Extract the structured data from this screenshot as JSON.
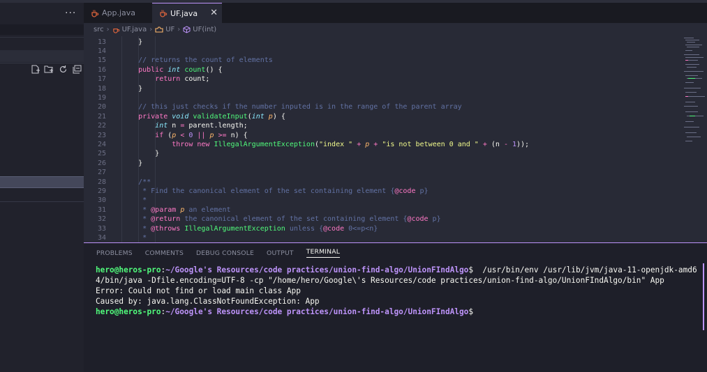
{
  "sidebar": {
    "more_label": "···"
  },
  "tabs": [
    {
      "label": "App.java",
      "active": false
    },
    {
      "label": "UF.java",
      "active": true,
      "close": "✕"
    }
  ],
  "breadcrumb": {
    "folder": "src",
    "file": "UF.java",
    "class": "UF",
    "method": "UF(int)"
  },
  "editor": {
    "lines": [
      {
        "num": "13",
        "indent": 1,
        "tokens": [
          {
            "t": "}",
            "c": ""
          }
        ]
      },
      {
        "num": "14",
        "indent": 0,
        "tokens": []
      },
      {
        "num": "15",
        "indent": 1,
        "tokens": [
          {
            "t": "// returns the count of elements",
            "c": "c"
          }
        ]
      },
      {
        "num": "16",
        "indent": 1,
        "tokens": [
          {
            "t": "public ",
            "c": "k"
          },
          {
            "t": "int ",
            "c": "t"
          },
          {
            "t": "count",
            "c": "f"
          },
          {
            "t": "() {",
            "c": ""
          }
        ]
      },
      {
        "num": "17",
        "indent": 2,
        "tokens": [
          {
            "t": "return ",
            "c": "k"
          },
          {
            "t": "count;",
            "c": ""
          }
        ]
      },
      {
        "num": "18",
        "indent": 1,
        "tokens": [
          {
            "t": "}",
            "c": ""
          }
        ]
      },
      {
        "num": "19",
        "indent": 0,
        "tokens": []
      },
      {
        "num": "20",
        "indent": 1,
        "tokens": [
          {
            "t": "// this just checks if the number inputed is in the range of the parent array",
            "c": "c"
          }
        ]
      },
      {
        "num": "21",
        "indent": 1,
        "tokens": [
          {
            "t": "private ",
            "c": "k"
          },
          {
            "t": "void ",
            "c": "t"
          },
          {
            "t": "validateInput",
            "c": "f"
          },
          {
            "t": "(",
            "c": ""
          },
          {
            "t": "int ",
            "c": "t"
          },
          {
            "t": "p",
            "c": "p"
          },
          {
            "t": ") {",
            "c": ""
          }
        ]
      },
      {
        "num": "22",
        "indent": 2,
        "tokens": [
          {
            "t": "int ",
            "c": "t"
          },
          {
            "t": "n ",
            "c": ""
          },
          {
            "t": "= ",
            "c": "k"
          },
          {
            "t": "parent.length;",
            "c": ""
          }
        ]
      },
      {
        "num": "23",
        "indent": 2,
        "tokens": [
          {
            "t": "if ",
            "c": "k"
          },
          {
            "t": "(",
            "c": ""
          },
          {
            "t": "p",
            "c": "p"
          },
          {
            "t": " < ",
            "c": "k"
          },
          {
            "t": "0",
            "c": "n"
          },
          {
            "t": " || ",
            "c": "k"
          },
          {
            "t": "p",
            "c": "p"
          },
          {
            "t": " >= ",
            "c": "k"
          },
          {
            "t": "n) {",
            "c": ""
          }
        ]
      },
      {
        "num": "24",
        "indent": 3,
        "tokens": [
          {
            "t": "throw ",
            "c": "k"
          },
          {
            "t": "new ",
            "c": "k"
          },
          {
            "t": "IllegalArgumentException",
            "c": "f"
          },
          {
            "t": "(",
            "c": ""
          },
          {
            "t": "\"index \"",
            "c": "s"
          },
          {
            "t": " + ",
            "c": "k"
          },
          {
            "t": "p",
            "c": "p"
          },
          {
            "t": " + ",
            "c": "k"
          },
          {
            "t": "\"is not between 0 and \"",
            "c": "s"
          },
          {
            "t": " + ",
            "c": "k"
          },
          {
            "t": "(n ",
            "c": ""
          },
          {
            "t": "- ",
            "c": "k"
          },
          {
            "t": "1",
            "c": "n"
          },
          {
            "t": "));",
            "c": ""
          }
        ]
      },
      {
        "num": "25",
        "indent": 2,
        "tokens": [
          {
            "t": "}",
            "c": ""
          }
        ]
      },
      {
        "num": "26",
        "indent": 1,
        "tokens": [
          {
            "t": "}",
            "c": ""
          }
        ]
      },
      {
        "num": "27",
        "indent": 0,
        "tokens": []
      },
      {
        "num": "28",
        "indent": 1,
        "tokens": [
          {
            "t": "/**",
            "c": "c"
          }
        ]
      },
      {
        "num": "29",
        "indent": 1,
        "tokens": [
          {
            "t": " * Find the canonical element of the set containing element {",
            "c": "c"
          },
          {
            "t": "@code",
            "c": "k"
          },
          {
            "t": " p}",
            "c": "c"
          }
        ]
      },
      {
        "num": "30",
        "indent": 1,
        "tokens": [
          {
            "t": " *",
            "c": "c"
          }
        ]
      },
      {
        "num": "31",
        "indent": 1,
        "tokens": [
          {
            "t": " * ",
            "c": "c"
          },
          {
            "t": "@param",
            "c": "k"
          },
          {
            "t": " ",
            "c": "c"
          },
          {
            "t": "p",
            "c": "p"
          },
          {
            "t": " an element",
            "c": "c"
          }
        ]
      },
      {
        "num": "32",
        "indent": 1,
        "tokens": [
          {
            "t": " * ",
            "c": "c"
          },
          {
            "t": "@return",
            "c": "k"
          },
          {
            "t": " the canonical element of the set containing element {",
            "c": "c"
          },
          {
            "t": "@code",
            "c": "k"
          },
          {
            "t": " p}",
            "c": "c"
          }
        ]
      },
      {
        "num": "33",
        "indent": 1,
        "tokens": [
          {
            "t": " * ",
            "c": "c"
          },
          {
            "t": "@throws",
            "c": "k"
          },
          {
            "t": " IllegalArgumentException",
            "c": "f"
          },
          {
            "t": " unless {",
            "c": "c"
          },
          {
            "t": "@code",
            "c": "k"
          },
          {
            "t": " 0<=p<n}",
            "c": "c"
          }
        ]
      },
      {
        "num": "34",
        "indent": 1,
        "tokens": [
          {
            "t": " *",
            "c": "c"
          }
        ]
      }
    ]
  },
  "panel": {
    "tabs": [
      {
        "label": "PROBLEMS",
        "active": false
      },
      {
        "label": "COMMENTS",
        "active": false
      },
      {
        "label": "DEBUG CONSOLE",
        "active": false
      },
      {
        "label": "OUTPUT",
        "active": false
      },
      {
        "label": "TERMINAL",
        "active": true
      }
    ],
    "terminal": {
      "user": "hero@heros-pro",
      "cwd": "~/Google's Resources/code practices/union-find-algo/UnionFIndAlgo",
      "command": "  /usr/bin/env /usr/lib/jvm/java-11-openjdk-amd64/bin/java -Dfile.encoding=UTF-8 -cp \"/home/hero/Google\\'s Resources/code practices/union-find-algo/UnionFIndAlgo/bin\" App",
      "error1": "Error: Could not find or load main class App",
      "error2": "Caused by: java.lang.ClassNotFoundException: App"
    }
  },
  "colors": {
    "accent": "#bd93f9",
    "background": "#282a36",
    "green": "#50fa7b",
    "pink": "#ff79c6"
  }
}
